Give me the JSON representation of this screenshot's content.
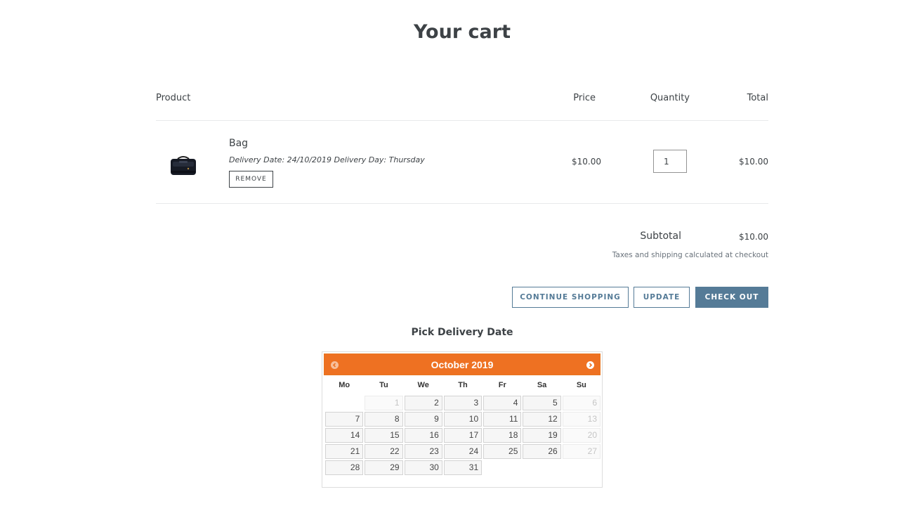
{
  "page": {
    "title": "Your cart"
  },
  "table_headers": {
    "product": "Product",
    "price": "Price",
    "quantity": "Quantity",
    "total": "Total"
  },
  "item": {
    "name": "Bag",
    "properties": "Delivery Date: 24/10/2019 Delivery Day: Thursday",
    "remove_label": "Remove",
    "price": "$10.00",
    "quantity": "1",
    "total": "$10.00"
  },
  "summary": {
    "subtotal_label": "Subtotal",
    "subtotal_value": "$10.00",
    "tax_note": "Taxes and shipping calculated at checkout"
  },
  "buttons": {
    "continue": "Continue shopping",
    "update": "Update",
    "checkout": "Check out"
  },
  "picker": {
    "title": "Pick Delivery Date",
    "month_label": "October 2019",
    "weekdays": [
      "Mo",
      "Tu",
      "We",
      "Th",
      "Fr",
      "Sa",
      "Su"
    ],
    "weeks": [
      [
        null,
        {
          "d": "1",
          "off": true
        },
        {
          "d": "2"
        },
        {
          "d": "3"
        },
        {
          "d": "4"
        },
        {
          "d": "5"
        },
        {
          "d": "6",
          "off": true
        }
      ],
      [
        {
          "d": "7"
        },
        {
          "d": "8"
        },
        {
          "d": "9"
        },
        {
          "d": "10"
        },
        {
          "d": "11"
        },
        {
          "d": "12"
        },
        {
          "d": "13",
          "off": true
        }
      ],
      [
        {
          "d": "14"
        },
        {
          "d": "15"
        },
        {
          "d": "16"
        },
        {
          "d": "17"
        },
        {
          "d": "18"
        },
        {
          "d": "19"
        },
        {
          "d": "20",
          "off": true
        }
      ],
      [
        {
          "d": "21"
        },
        {
          "d": "22"
        },
        {
          "d": "23"
        },
        {
          "d": "24"
        },
        {
          "d": "25"
        },
        {
          "d": "26"
        },
        {
          "d": "27",
          "off": true
        }
      ],
      [
        {
          "d": "28"
        },
        {
          "d": "29"
        },
        {
          "d": "30"
        },
        {
          "d": "31"
        },
        null,
        null,
        null
      ]
    ],
    "header_color": "#ee7122"
  },
  "colors": {
    "accent": "#557b97",
    "text": "#3d4246"
  }
}
